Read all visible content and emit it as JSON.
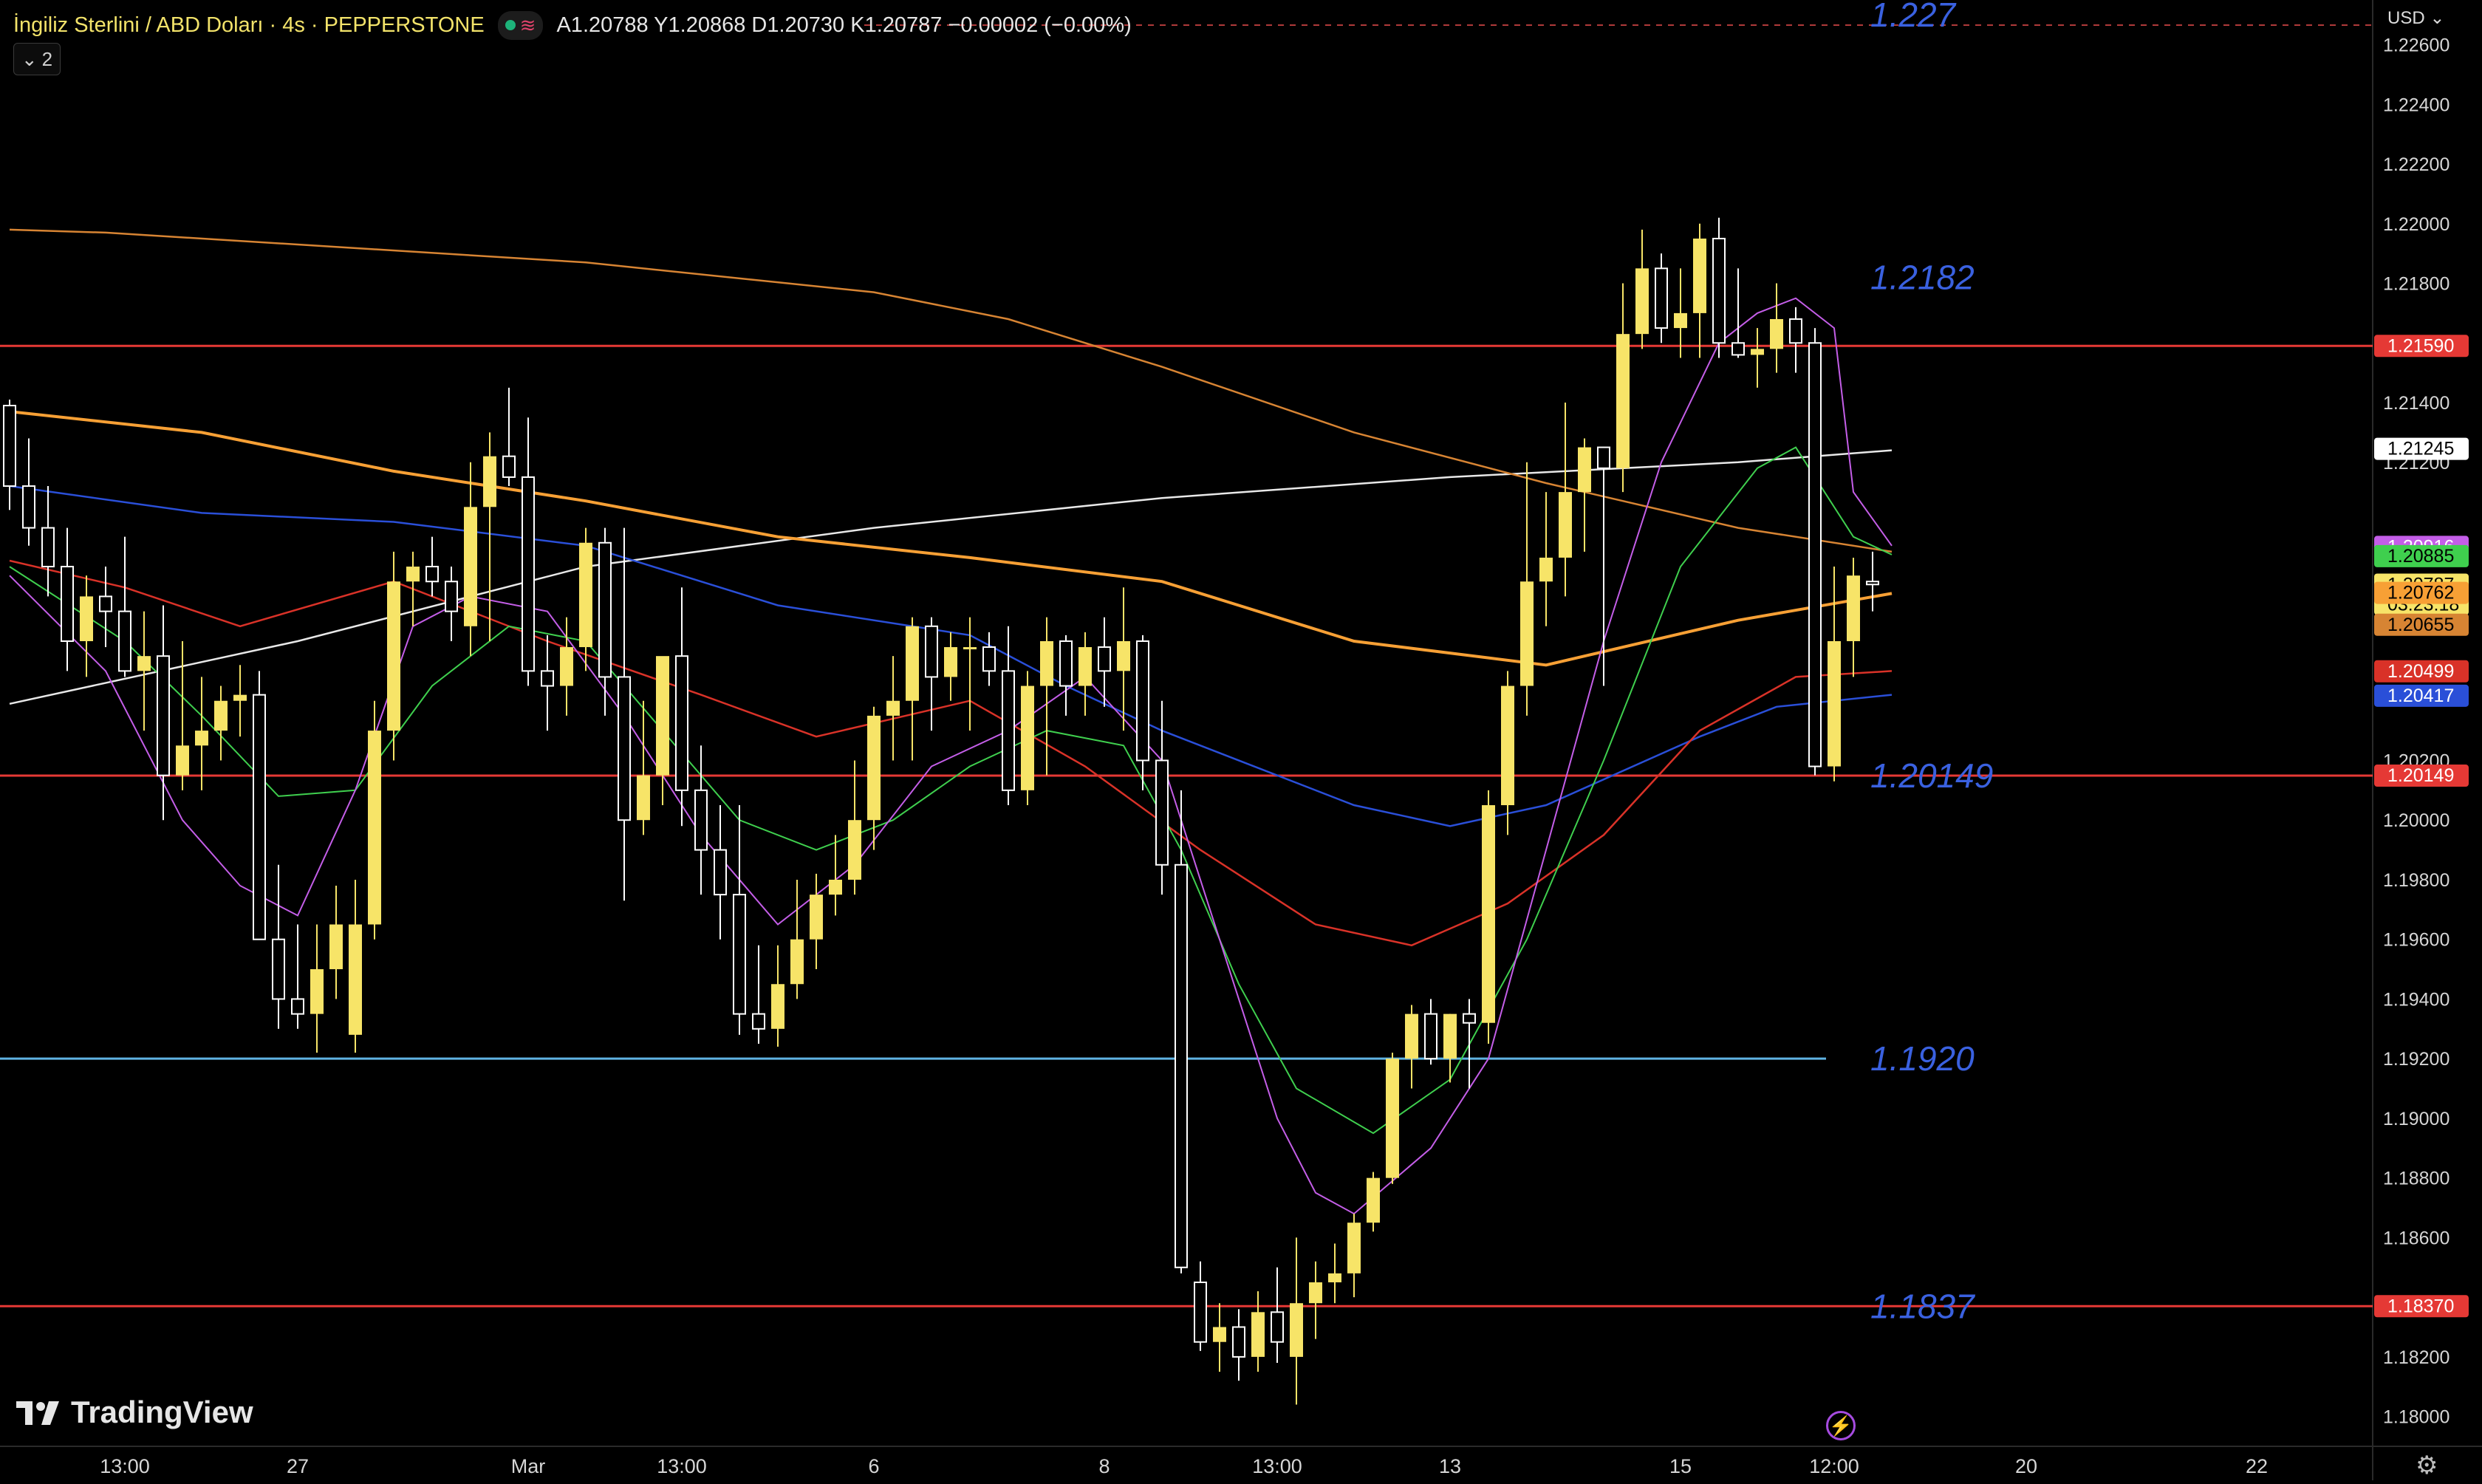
{
  "header": {
    "symbol": "İngiliz Sterlini / ABD Doları · 4s · PEPPERSTONE",
    "ohlc": "A1.20788  Y1.20868  D1.20730  K1.20787  −0.00002 (−0.00%)",
    "collapse_count": "2"
  },
  "currency": "USD",
  "branding": "TradingView",
  "colors": {
    "bull": "#f7e468",
    "bear": "#ffffff",
    "hline": "#e53935",
    "hline_blue": "#5fb3e3",
    "annot": "#3a61e0",
    "ema_purple": "#c45ee8",
    "ema_green": "#3fcf4e",
    "ema_red": "#d93228",
    "ema_blue": "#2a4fd8",
    "ema_orange": "#f7a035",
    "ema_orange_thin": "#d78433",
    "ma_white": "#e8e8e8"
  },
  "chart_data": {
    "type": "candlestick",
    "title": "İngiliz Sterlini / ABD Doları · 4s · PEPPERSTONE",
    "ylim": [
      1.179,
      1.2275
    ],
    "y_ticks": [
      "1.22600",
      "1.22400",
      "1.22200",
      "1.22000",
      "1.21800",
      "1.21400",
      "1.21200",
      "1.20200",
      "1.20000",
      "1.19800",
      "1.19600",
      "1.19400",
      "1.19200",
      "1.19000",
      "1.18800",
      "1.18600",
      "1.18200",
      "1.18000"
    ],
    "x_ticks": [
      "13:00",
      "27",
      "Mar",
      "13:00",
      "6",
      "8",
      "13:00",
      "13",
      "15",
      "12:00",
      "20",
      "22"
    ],
    "x_tick_index": [
      6,
      15,
      27,
      35,
      45,
      57,
      66,
      75,
      87,
      95,
      105,
      117
    ],
    "candles": [
      [
        1.2139,
        1.2141,
        1.2104,
        1.2112
      ],
      [
        1.2112,
        1.2128,
        1.2092,
        1.2098
      ],
      [
        1.2098,
        1.2112,
        1.2075,
        1.2085
      ],
      [
        1.2085,
        1.2098,
        1.205,
        1.206
      ],
      [
        1.206,
        1.2082,
        1.2048,
        1.2075
      ],
      [
        1.2075,
        1.2085,
        1.2058,
        1.207
      ],
      [
        1.207,
        1.2095,
        1.2048,
        1.205
      ],
      [
        1.205,
        1.207,
        1.203,
        1.2055
      ],
      [
        1.2055,
        1.2072,
        1.2,
        1.2015
      ],
      [
        1.2015,
        1.206,
        1.201,
        1.2025
      ],
      [
        1.2025,
        1.2048,
        1.201,
        1.203
      ],
      [
        1.203,
        1.2045,
        1.202,
        1.204
      ],
      [
        1.204,
        1.2052,
        1.2028,
        1.2042
      ],
      [
        1.2042,
        1.205,
        1.196,
        1.196
      ],
      [
        1.196,
        1.1985,
        1.193,
        1.194
      ],
      [
        1.194,
        1.1965,
        1.193,
        1.1935
      ],
      [
        1.1935,
        1.1965,
        1.1922,
        1.195
      ],
      [
        1.195,
        1.1978,
        1.194,
        1.1965
      ],
      [
        1.1928,
        1.198,
        1.1922,
        1.1965
      ],
      [
        1.1965,
        1.204,
        1.196,
        1.203
      ],
      [
        1.203,
        1.209,
        1.202,
        1.208
      ],
      [
        1.208,
        1.209,
        1.2065,
        1.2085
      ],
      [
        1.2085,
        1.2095,
        1.2075,
        1.208
      ],
      [
        1.208,
        1.2085,
        1.206,
        1.207
      ],
      [
        1.2065,
        1.212,
        1.2055,
        1.2105
      ],
      [
        1.2105,
        1.213,
        1.206,
        1.2122
      ],
      [
        1.2122,
        1.2145,
        1.2112,
        1.2115
      ],
      [
        1.2115,
        1.2135,
        1.2045,
        1.205
      ],
      [
        1.205,
        1.2062,
        1.203,
        1.2045
      ],
      [
        1.2045,
        1.2068,
        1.2035,
        1.2058
      ],
      [
        1.2058,
        1.2098,
        1.205,
        1.2093
      ],
      [
        1.2093,
        1.2098,
        1.2035,
        1.2048
      ],
      [
        1.2048,
        1.2098,
        1.1973,
        1.2
      ],
      [
        1.2,
        1.204,
        1.1995,
        1.2015
      ],
      [
        1.2015,
        1.2045,
        1.2005,
        1.2055
      ],
      [
        1.2055,
        1.2078,
        1.1998,
        1.201
      ],
      [
        1.201,
        1.2025,
        1.1975,
        1.199
      ],
      [
        1.199,
        1.2005,
        1.196,
        1.1975
      ],
      [
        1.1975,
        1.2005,
        1.1928,
        1.1935
      ],
      [
        1.1935,
        1.1958,
        1.1925,
        1.193
      ],
      [
        1.193,
        1.1958,
        1.1924,
        1.1945
      ],
      [
        1.1945,
        1.198,
        1.194,
        1.196
      ],
      [
        1.196,
        1.1982,
        1.195,
        1.1975
      ],
      [
        1.1975,
        1.1995,
        1.1968,
        1.198
      ],
      [
        1.198,
        1.202,
        1.1975,
        1.2
      ],
      [
        1.2,
        1.2038,
        1.199,
        1.2035
      ],
      [
        1.2035,
        1.2055,
        1.202,
        1.204
      ],
      [
        1.204,
        1.2068,
        1.202,
        1.2065
      ],
      [
        1.2065,
        1.2068,
        1.203,
        1.2048
      ],
      [
        1.2048,
        1.2063,
        1.204,
        1.2058
      ],
      [
        1.2058,
        1.2068,
        1.203,
        1.2058
      ],
      [
        1.2058,
        1.2063,
        1.2045,
        1.205
      ],
      [
        1.205,
        1.2065,
        1.2005,
        1.201
      ],
      [
        1.201,
        1.205,
        1.2005,
        1.2045
      ],
      [
        1.2045,
        1.2068,
        1.2015,
        1.206
      ],
      [
        1.206,
        1.2062,
        1.2035,
        1.2045
      ],
      [
        1.2045,
        1.2063,
        1.2035,
        1.2058
      ],
      [
        1.2058,
        1.2068,
        1.2038,
        1.205
      ],
      [
        1.205,
        1.2078,
        1.203,
        1.206
      ],
      [
        1.206,
        1.2062,
        1.201,
        1.202
      ],
      [
        1.202,
        1.204,
        1.1975,
        1.1985
      ],
      [
        1.1985,
        1.201,
        1.1848,
        1.185
      ],
      [
        1.1845,
        1.1852,
        1.1822,
        1.1825
      ],
      [
        1.1825,
        1.1838,
        1.1815,
        1.183
      ],
      [
        1.183,
        1.1836,
        1.1812,
        1.182
      ],
      [
        1.182,
        1.1842,
        1.1815,
        1.1835
      ],
      [
        1.1835,
        1.185,
        1.1818,
        1.1825
      ],
      [
        1.182,
        1.186,
        1.1804,
        1.1838
      ],
      [
        1.1838,
        1.1852,
        1.1826,
        1.1845
      ],
      [
        1.1845,
        1.1858,
        1.1838,
        1.1848
      ],
      [
        1.1848,
        1.1868,
        1.184,
        1.1865
      ],
      [
        1.1865,
        1.1882,
        1.1862,
        1.188
      ],
      [
        1.188,
        1.1922,
        1.1878,
        1.192
      ],
      [
        1.192,
        1.1938,
        1.191,
        1.1935
      ],
      [
        1.1935,
        1.194,
        1.1918,
        1.192
      ],
      [
        1.192,
        1.1935,
        1.1912,
        1.1935
      ],
      [
        1.1935,
        1.194,
        1.191,
        1.1932
      ],
      [
        1.1932,
        1.201,
        1.1925,
        1.2005
      ],
      [
        1.2005,
        1.205,
        1.1995,
        1.2045
      ],
      [
        1.2045,
        1.212,
        1.2035,
        1.208
      ],
      [
        1.208,
        1.211,
        1.2065,
        1.2088
      ],
      [
        1.2088,
        1.214,
        1.2075,
        1.211
      ],
      [
        1.211,
        1.2128,
        1.209,
        1.2125
      ],
      [
        1.2125,
        1.2123,
        1.2045,
        1.2118
      ],
      [
        1.2118,
        1.218,
        1.211,
        1.2163
      ],
      [
        1.2163,
        1.2198,
        1.2158,
        1.2185
      ],
      [
        1.2185,
        1.219,
        1.216,
        1.2165
      ],
      [
        1.2165,
        1.2185,
        1.2155,
        1.217
      ],
      [
        1.217,
        1.22,
        1.2155,
        1.2195
      ],
      [
        1.2195,
        1.2202,
        1.2155,
        1.216
      ],
      [
        1.216,
        1.2185,
        1.2155,
        1.2156
      ],
      [
        1.2156,
        1.2165,
        1.2145,
        1.2158
      ],
      [
        1.2158,
        1.218,
        1.215,
        1.2168
      ],
      [
        1.2168,
        1.2172,
        1.215,
        1.216
      ],
      [
        1.216,
        1.2165,
        1.2015,
        1.2018
      ],
      [
        1.2018,
        1.2085,
        1.2013,
        1.206
      ],
      [
        1.206,
        1.2088,
        1.2048,
        1.2082
      ],
      [
        1.208,
        1.209,
        1.207,
        1.2079
      ]
    ],
    "horizontal_lines": [
      {
        "value": 1.2159,
        "label": "1.21590",
        "color": "#e53935"
      },
      {
        "value": 1.20149,
        "label": "1.20149",
        "color": "#e53935"
      },
      {
        "value": 1.1837,
        "label": "1.18370",
        "color": "#e53935"
      },
      {
        "value": 1.192,
        "label": "",
        "color": "#5fb3e3"
      }
    ],
    "annotations": [
      {
        "text": "1.227",
        "value": 1.227
      },
      {
        "text": "1.2182",
        "value": 1.2182
      },
      {
        "text": "1.20149",
        "value": 1.20149
      },
      {
        "text": "1.1920",
        "value": 1.192
      },
      {
        "text": "1.1837",
        "value": 1.1837
      }
    ],
    "price_badges": [
      {
        "label": "1.21590",
        "value": 1.2159,
        "bg": "#e53935",
        "fg": "#ffffff"
      },
      {
        "label": "1.21245",
        "value": 1.21245,
        "bg": "#ffffff",
        "fg": "#000000"
      },
      {
        "label": "1.20916",
        "value": 1.20916,
        "bg": "#c45ee8",
        "fg": "#ffffff"
      },
      {
        "label": "1.20885",
        "value": 1.20885,
        "bg": "#3fcf4e",
        "fg": "#000000"
      },
      {
        "label": "1.20787",
        "sub": "03:23:18",
        "value": 1.20787,
        "bg": "#f7e468",
        "fg": "#000000"
      },
      {
        "label": "1.20762",
        "value": 1.20762,
        "bg": "#f7a035",
        "fg": "#000000"
      },
      {
        "label": "1.20655",
        "value": 1.20655,
        "bg": "#d78433",
        "fg": "#000000"
      },
      {
        "label": "1.20499",
        "value": 1.20499,
        "bg": "#d93228",
        "fg": "#ffffff"
      },
      {
        "label": "1.20417",
        "value": 1.20417,
        "bg": "#2a4fd8",
        "fg": "#ffffff"
      },
      {
        "label": "1.20149",
        "value": 1.20149,
        "bg": "#e53935",
        "fg": "#ffffff"
      },
      {
        "label": "1.18370",
        "value": 1.1837,
        "bg": "#e53935",
        "fg": "#ffffff"
      }
    ],
    "indicator_lines": [
      {
        "color": "#e8e8e8",
        "width": 2.5,
        "points": [
          [
            0,
            1.2039
          ],
          [
            15,
            1.206
          ],
          [
            30,
            1.2085
          ],
          [
            45,
            1.2098
          ],
          [
            60,
            1.2108
          ],
          [
            75,
            1.2115
          ],
          [
            90,
            1.212
          ],
          [
            98,
            1.2124
          ]
        ]
      },
      {
        "color": "#d78433",
        "width": 2.5,
        "points": [
          [
            0,
            1.2198
          ],
          [
            5,
            1.2197
          ],
          [
            15,
            1.2193
          ],
          [
            30,
            1.2187
          ],
          [
            45,
            1.2177
          ],
          [
            52,
            1.2168
          ],
          [
            60,
            1.2152
          ],
          [
            70,
            1.213
          ],
          [
            80,
            1.2113
          ],
          [
            90,
            1.2098
          ],
          [
            98,
            1.209
          ]
        ]
      },
      {
        "color": "#f7a035",
        "width": 4,
        "points": [
          [
            0,
            1.2137
          ],
          [
            10,
            1.213
          ],
          [
            20,
            1.2117
          ],
          [
            30,
            1.2107
          ],
          [
            40,
            1.2095
          ],
          [
            50,
            1.2088
          ],
          [
            60,
            1.208
          ],
          [
            70,
            1.206
          ],
          [
            80,
            1.2052
          ],
          [
            90,
            1.2067
          ],
          [
            98,
            1.2076
          ]
        ]
      },
      {
        "color": "#2a4fd8",
        "width": 2.5,
        "points": [
          [
            0,
            1.2112
          ],
          [
            10,
            1.2103
          ],
          [
            20,
            1.21
          ],
          [
            30,
            1.2092
          ],
          [
            40,
            1.2072
          ],
          [
            50,
            1.2062
          ],
          [
            55,
            1.2045
          ],
          [
            60,
            1.203
          ],
          [
            70,
            1.2005
          ],
          [
            75,
            1.1998
          ],
          [
            80,
            1.2005
          ],
          [
            88,
            1.2028
          ],
          [
            92,
            1.2038
          ],
          [
            98,
            1.2042
          ]
        ]
      },
      {
        "color": "#d93228",
        "width": 2.5,
        "points": [
          [
            0,
            1.2087
          ],
          [
            6,
            1.2078
          ],
          [
            12,
            1.2065
          ],
          [
            20,
            1.208
          ],
          [
            28,
            1.206
          ],
          [
            36,
            1.2042
          ],
          [
            42,
            1.2028
          ],
          [
            50,
            1.204
          ],
          [
            56,
            1.2018
          ],
          [
            62,
            1.199
          ],
          [
            68,
            1.1965
          ],
          [
            73,
            1.1958
          ],
          [
            78,
            1.1972
          ],
          [
            83,
            1.1995
          ],
          [
            88,
            1.203
          ],
          [
            93,
            1.2048
          ],
          [
            98,
            1.205
          ]
        ]
      },
      {
        "color": "#3fcf4e",
        "width": 2,
        "points": [
          [
            0,
            1.2085
          ],
          [
            6,
            1.206
          ],
          [
            10,
            1.2035
          ],
          [
            14,
            1.2008
          ],
          [
            18,
            1.201
          ],
          [
            22,
            1.2045
          ],
          [
            26,
            1.2065
          ],
          [
            30,
            1.206
          ],
          [
            34,
            1.203
          ],
          [
            38,
            1.2
          ],
          [
            42,
            1.199
          ],
          [
            46,
            1.2
          ],
          [
            50,
            1.2018
          ],
          [
            54,
            1.203
          ],
          [
            58,
            1.2025
          ],
          [
            61,
            1.199
          ],
          [
            64,
            1.1945
          ],
          [
            67,
            1.191
          ],
          [
            71,
            1.1895
          ],
          [
            75,
            1.1913
          ],
          [
            79,
            1.196
          ],
          [
            83,
            1.202
          ],
          [
            87,
            1.2085
          ],
          [
            91,
            1.2118
          ],
          [
            93,
            1.2125
          ],
          [
            96,
            1.2095
          ],
          [
            98,
            1.2089
          ]
        ]
      },
      {
        "color": "#c45ee8",
        "width": 2,
        "points": [
          [
            0,
            1.2082
          ],
          [
            5,
            1.205
          ],
          [
            9,
            1.2
          ],
          [
            12,
            1.1978
          ],
          [
            15,
            1.1968
          ],
          [
            18,
            1.201
          ],
          [
            21,
            1.2065
          ],
          [
            24,
            1.2075
          ],
          [
            28,
            1.207
          ],
          [
            32,
            1.2035
          ],
          [
            36,
            1.1995
          ],
          [
            40,
            1.1965
          ],
          [
            44,
            1.1985
          ],
          [
            48,
            1.2018
          ],
          [
            52,
            1.203
          ],
          [
            56,
            1.2048
          ],
          [
            60,
            1.202
          ],
          [
            63,
            1.196
          ],
          [
            66,
            1.19
          ],
          [
            68,
            1.1875
          ],
          [
            70,
            1.1868
          ],
          [
            74,
            1.189
          ],
          [
            77,
            1.192
          ],
          [
            80,
            1.199
          ],
          [
            83,
            1.206
          ],
          [
            86,
            1.212
          ],
          [
            89,
            1.216
          ],
          [
            91,
            1.217
          ],
          [
            93,
            1.2175
          ],
          [
            95,
            1.2165
          ],
          [
            96,
            1.211
          ],
          [
            98,
            1.2092
          ]
        ]
      }
    ]
  }
}
